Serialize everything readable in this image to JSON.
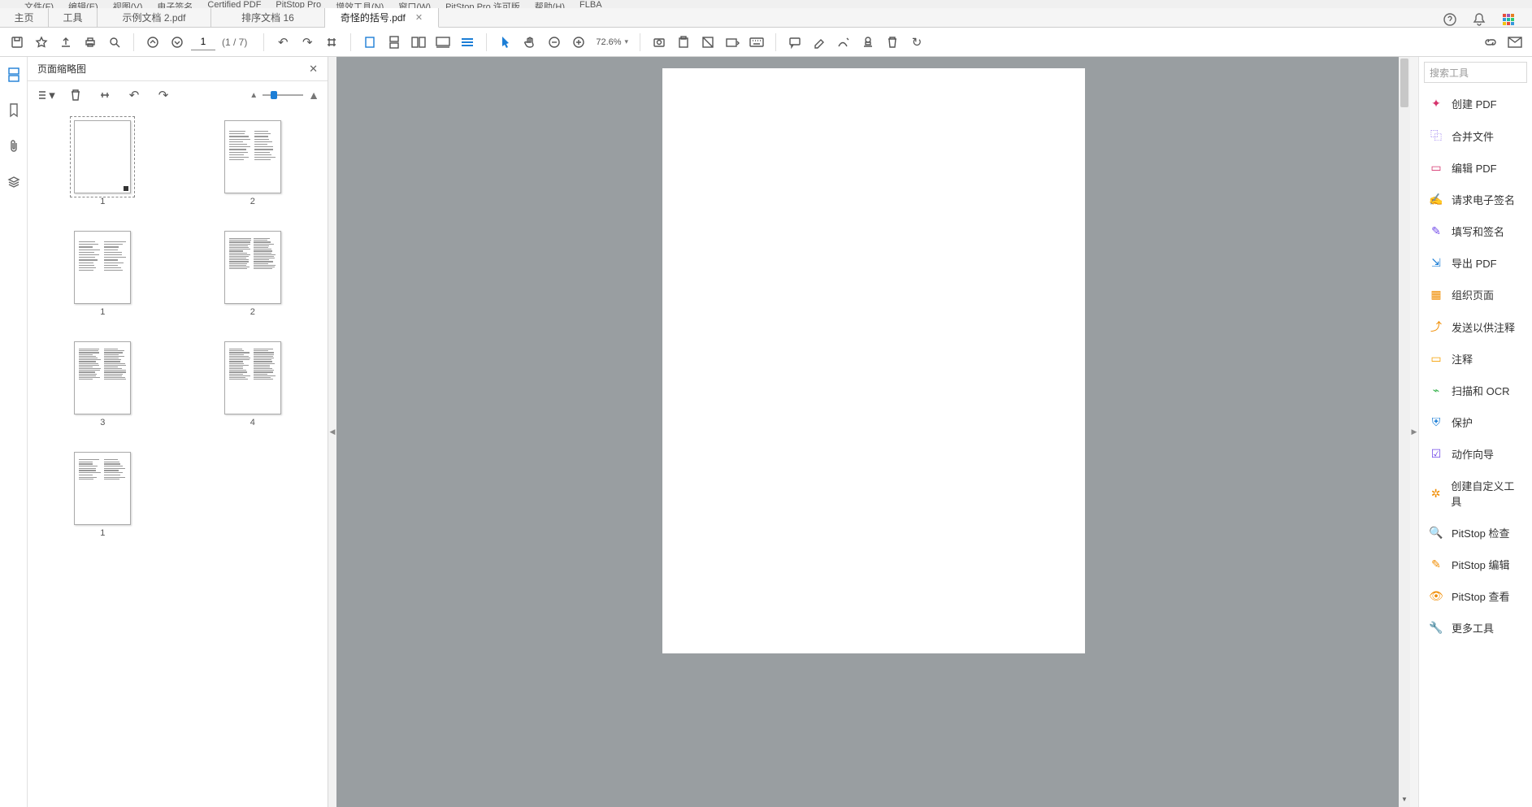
{
  "menubar": [
    "文件(F)",
    "编辑(E)",
    "视图(V)",
    "电子签名",
    "Certified PDF",
    "PitStop Pro",
    "增效工具(N)",
    "窗口(W)",
    "PitStop Pro 许可版",
    "帮助(H)",
    "FLBA"
  ],
  "tabs": {
    "items": [
      {
        "label": "主页",
        "wide": false
      },
      {
        "label": "工具",
        "wide": false
      },
      {
        "label": "示例文档 2.pdf",
        "wide": true
      },
      {
        "label": "排序文档 16",
        "wide": true
      },
      {
        "label": "奇怪的括号.pdf",
        "wide": true,
        "closable": true,
        "active": true
      }
    ]
  },
  "toolbar": {
    "page_current": "1",
    "page_total": "(1 / 7)",
    "zoom": "72.6%"
  },
  "panelThumbs": {
    "title": "页面缩略图",
    "thumbs": [
      {
        "label": "1",
        "selected": true,
        "style": 0
      },
      {
        "label": "2",
        "selected": false,
        "style": 1
      },
      {
        "label": "1",
        "selected": false,
        "style": 2
      },
      {
        "label": "2",
        "selected": false,
        "style": 3
      },
      {
        "label": "3",
        "selected": false,
        "style": 3
      },
      {
        "label": "4",
        "selected": false,
        "style": 3
      },
      {
        "label": "1",
        "selected": false,
        "style": 4
      }
    ]
  },
  "rightPanel": {
    "search_placeholder": "搜索工具",
    "tools": [
      {
        "label": "创建 PDF",
        "color": "c-pink",
        "glyph": "✦"
      },
      {
        "label": "合并文件",
        "color": "c-purple",
        "glyph": "⿻"
      },
      {
        "label": "编辑 PDF",
        "color": "c-pink",
        "glyph": "▭"
      },
      {
        "label": "请求电子签名",
        "color": "c-purple",
        "glyph": "✍"
      },
      {
        "label": "填写和签名",
        "color": "c-purple",
        "glyph": "✎"
      },
      {
        "label": "导出 PDF",
        "color": "c-blue",
        "glyph": "⇲"
      },
      {
        "label": "组织页面",
        "color": "c-orange",
        "glyph": "▦"
      },
      {
        "label": "发送以供注释",
        "color": "c-orange",
        "glyph": "⤴"
      },
      {
        "label": "注释",
        "color": "c-yellow",
        "glyph": "▭"
      },
      {
        "label": "扫描和 OCR",
        "color": "c-green",
        "glyph": "⌁"
      },
      {
        "label": "保护",
        "color": "c-blue",
        "glyph": "⛨"
      },
      {
        "label": "动作向导",
        "color": "c-purple",
        "glyph": "☑"
      },
      {
        "label": "创建自定义工具",
        "color": "c-orange",
        "glyph": "✲"
      },
      {
        "label": "PitStop 检查",
        "color": "c-orange",
        "glyph": "🔍"
      },
      {
        "label": "PitStop 编辑",
        "color": "c-orange",
        "glyph": "✎"
      },
      {
        "label": "PitStop 查看",
        "color": "c-orange",
        "glyph": "👁"
      },
      {
        "label": "更多工具",
        "color": "c-gray",
        "glyph": "🔧"
      }
    ]
  }
}
